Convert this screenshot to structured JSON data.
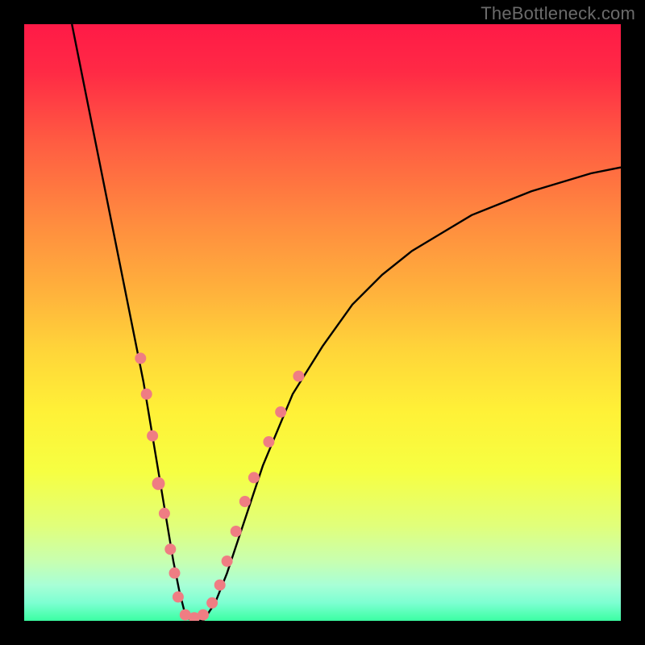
{
  "watermark": "TheBottleneck.com",
  "chart_data": {
    "type": "line",
    "title": "",
    "xlabel": "",
    "ylabel": "",
    "xlim": [
      0,
      100
    ],
    "ylim": [
      0,
      100
    ],
    "grid": false,
    "legend": false,
    "series": [
      {
        "name": "curve",
        "stroke": "#000000",
        "x": [
          8,
          10,
          12,
          14,
          16,
          18,
          20,
          22,
          23,
          24,
          25,
          26,
          27,
          28,
          30,
          32,
          34,
          36,
          38,
          40,
          45,
          50,
          55,
          60,
          65,
          70,
          75,
          80,
          85,
          90,
          95,
          100
        ],
        "values": [
          100,
          90,
          80,
          70,
          60,
          50,
          40,
          28,
          22,
          16,
          10,
          5,
          1,
          0,
          0,
          3,
          8,
          14,
          20,
          26,
          38,
          46,
          53,
          58,
          62,
          65,
          68,
          70,
          72,
          73.5,
          75,
          76
        ]
      }
    ],
    "markers": [
      {
        "x": 19.5,
        "y": 44,
        "r": 7
      },
      {
        "x": 20.5,
        "y": 38,
        "r": 7
      },
      {
        "x": 21.5,
        "y": 31,
        "r": 7
      },
      {
        "x": 22.5,
        "y": 23,
        "r": 8
      },
      {
        "x": 23.5,
        "y": 18,
        "r": 7
      },
      {
        "x": 24.5,
        "y": 12,
        "r": 7
      },
      {
        "x": 25.2,
        "y": 8,
        "r": 7
      },
      {
        "x": 25.8,
        "y": 4,
        "r": 7
      },
      {
        "x": 27.0,
        "y": 1,
        "r": 7
      },
      {
        "x": 28.5,
        "y": 0.5,
        "r": 7
      },
      {
        "x": 30.0,
        "y": 1,
        "r": 7
      },
      {
        "x": 31.5,
        "y": 3,
        "r": 7
      },
      {
        "x": 32.8,
        "y": 6,
        "r": 7
      },
      {
        "x": 34.0,
        "y": 10,
        "r": 7
      },
      {
        "x": 35.5,
        "y": 15,
        "r": 7
      },
      {
        "x": 37.0,
        "y": 20,
        "r": 7
      },
      {
        "x": 38.5,
        "y": 24,
        "r": 7
      },
      {
        "x": 41.0,
        "y": 30,
        "r": 7
      },
      {
        "x": 43.0,
        "y": 35,
        "r": 7
      },
      {
        "x": 46.0,
        "y": 41,
        "r": 7
      }
    ],
    "marker_color": "#ef7d83"
  }
}
